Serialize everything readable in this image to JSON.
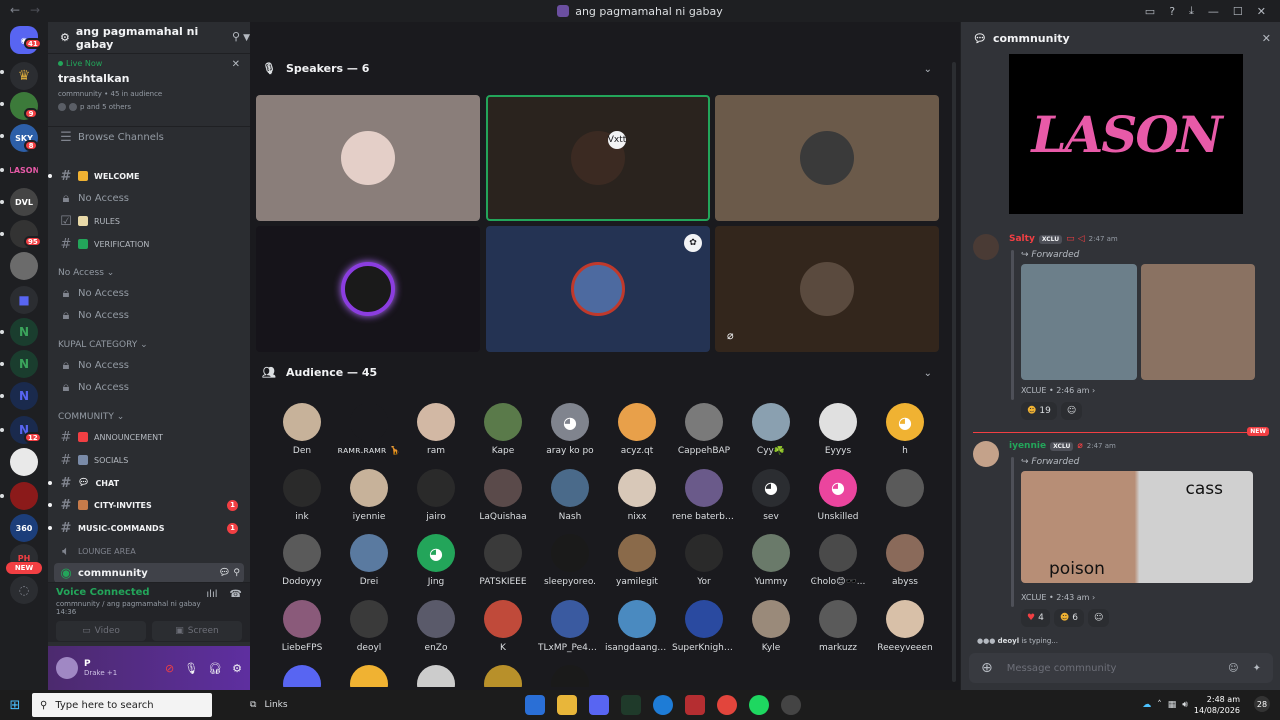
{
  "window": {
    "title": "ang pagmamahal ni gabay"
  },
  "guilds": {
    "home_badge": "41",
    "badges": [
      "9",
      "8",
      "95",
      "12"
    ],
    "new_label": "NEW",
    "server_360": "360"
  },
  "server": {
    "name": "ang pagmamahal ni gabay"
  },
  "live": {
    "status": "Live Now",
    "title": "trashtalkan",
    "meta": "commnunity • 45 in audience",
    "others": "p and 5 others"
  },
  "channels": {
    "browse": "Browse Channels",
    "welcome": "WELCOME",
    "no_access_1": "No Access",
    "rules": "RULES",
    "verification": "VERIFICATION",
    "cat_no_access": "No Access",
    "no_access_2": "No Access",
    "no_access_3": "No Access",
    "cat_kupal": "KUPAL CATEGORY",
    "no_access_4": "No Access",
    "no_access_5": "No Access",
    "cat_community": "COMMUNITY",
    "announcement": "ANNOUNCEMENT",
    "socials": "SOCIALS",
    "chat": "CHAT",
    "city_invites": "CITY-INVITES",
    "city_invites_count": "1",
    "music_commands": "MUSIC-COMMANDS",
    "music_commands_count": "1",
    "lounge": "LOUNGE AREA",
    "stage": "commnunity"
  },
  "voice": {
    "status": "Voice Connected",
    "location": "commnunity / ang pagmamahal ni gabay",
    "time": "14:36",
    "video": "Video",
    "screen": "Screen"
  },
  "user": {
    "name": "P",
    "status": "Drake +1"
  },
  "speakers": {
    "header": "Speakers — 6",
    "badge": "Vxtt"
  },
  "audience": {
    "header": "Audience — 45",
    "members": [
      "Den",
      "ʀᴀᴍʀ.ʀᴀᴍʀ 🦒",
      "ram",
      "Kape",
      "aray ko po",
      "acyz.qt",
      "CappehBAP",
      "Cyy☘️",
      "Eyyys",
      "h",
      "ink",
      "iyennie",
      "jairo",
      "LaQuishaa",
      "Nash",
      "nixx",
      "rene baterbon...",
      "sev",
      "Unskilled",
      "",
      "Dodoyyy",
      "Drei",
      "Jing",
      "PATSKIEEE",
      "sleepyoreo.",
      "yamilegit",
      "Yor",
      "Yummy",
      "Ͼholo😊🕶️...",
      "abyss",
      "LiebeFPS",
      "deoyl",
      "enZo",
      "K",
      "TLxMP_Pe4nut",
      "isangdaangro...",
      "SuperKnighth...",
      "Kyle",
      "markuzz",
      "Reeeyveeen"
    ]
  },
  "thread": {
    "title": "commnunity",
    "banner_text": "LASON",
    "msg1": {
      "author": "Salty",
      "tag": "XCLU",
      "time": "2:47 am",
      "forwarded": "Forwarded",
      "source": "XCLUE • 2:46 am",
      "reaction_count": "19"
    },
    "new_label": "NEW",
    "msg2": {
      "author": "iyennie",
      "tag": "XCLU",
      "time": "2:47 am",
      "forwarded": "Forwarded",
      "img_text_1": "poison",
      "img_text_2": "cass",
      "source": "XCLUE • 2:43 am",
      "reaction1": "4",
      "reaction2": "6"
    },
    "typing_user": "deoyl",
    "typing_text": " is typing...",
    "placeholder": "Message commnunity"
  },
  "taskbar": {
    "search": "Type here to search",
    "links": "Links",
    "time": "2:48 am",
    "date": "14/08/2026",
    "notif": "28"
  },
  "colors": {
    "accent": "#5865f2",
    "live": "#23a55a",
    "danger": "#f23f43"
  }
}
